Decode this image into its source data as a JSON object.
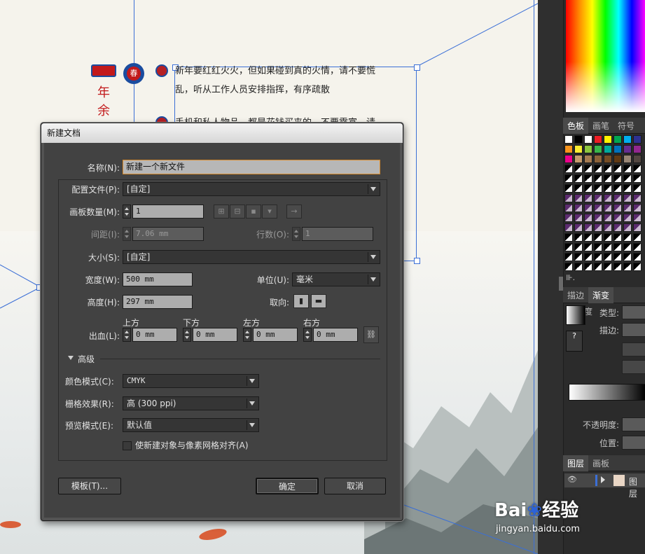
{
  "document": {
    "para1_line1": "新年要红红火火，但如果碰到真的火情，请不要慌",
    "para1_line2": "乱，听从工作人员安排指挥，有序疏散",
    "para2_line1": "手机和私人物品，都是花钱买来的，不要露富，请"
  },
  "art": {
    "vertical_title": [
      "年",
      "余"
    ],
    "badge_char": "春"
  },
  "dialog": {
    "title": "新建文档",
    "name_label": "名称(N):",
    "name_value": "新建一个新文件",
    "profile_label": "配置文件(P):",
    "profile_value": "[自定]",
    "artboards_label": "画板数量(M):",
    "artboards_value": "1",
    "arrange_arrow": "→",
    "spacing_label": "间距(I):",
    "spacing_value": "7.06 mm",
    "columns_label": "行数(O):",
    "columns_value": "1",
    "size_label": "大小(S):",
    "size_value": "[自定]",
    "width_label": "宽度(W):",
    "width_value": "500 mm",
    "units_label": "单位(U):",
    "units_value": "毫米",
    "height_label": "高度(H):",
    "height_value": "297 mm",
    "orientation_label": "取向:",
    "bleed_label": "出血(L):",
    "bleed_top_label": "上方",
    "bleed_bottom_label": "下方",
    "bleed_left_label": "左方",
    "bleed_right_label": "右方",
    "bleed_top": "0 mm",
    "bleed_bottom": "0 mm",
    "bleed_left": "0 mm",
    "bleed_right": "0 mm",
    "advanced_label": "高级",
    "color_mode_label": "颜色模式(C):",
    "color_mode_value": "CMYK",
    "raster_label": "栅格效果(R):",
    "raster_value": "高 (300 ppi)",
    "preview_label": "预览模式(E):",
    "preview_value": "默认值",
    "align_pixel_label": "使新建对象与像素网格对齐(A)",
    "align_pixel_checked": false,
    "templates_button": "模板(T)...",
    "ok_button": "确定",
    "cancel_button": "取消"
  },
  "panels": {
    "swatches_tabs": [
      "色板",
      "画笔",
      "符号"
    ],
    "stroke_tabs": [
      "描边",
      "渐变",
      "透明度"
    ],
    "type_label": "类型:",
    "stroke_label": "描边:",
    "opacity_label": "不透明度:",
    "position_label": "位置:",
    "question_mark": "?",
    "layers_tabs": [
      "图层",
      "画板"
    ],
    "layer_name": "图层"
  },
  "watermark": {
    "brand": "Bai",
    "brand2": "经验",
    "url": "jingyan.baidu.com"
  },
  "colors": {
    "dialog_bg": "#424242",
    "title_bar": "#e6e6e6",
    "accent_guide": "#3b6fd6",
    "red_text": "#c2191b"
  }
}
